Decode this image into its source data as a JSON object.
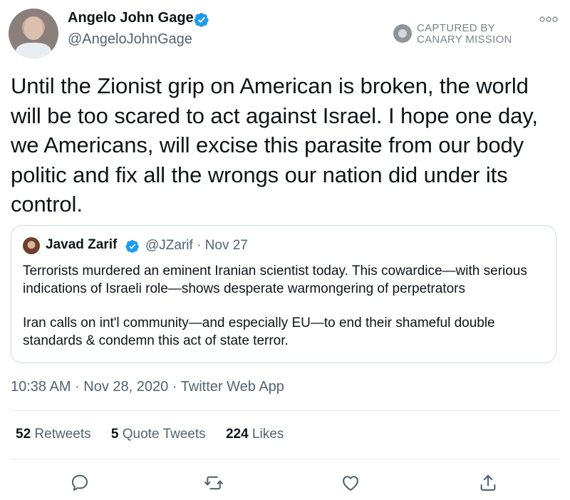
{
  "author": {
    "display_name": "Angelo John Gage",
    "handle": "@AngeloJohnGage",
    "verified": true
  },
  "watermark": {
    "line1": "CAPTURED BY",
    "line2": "CANARY MISSION"
  },
  "tweet": {
    "text": "Until the Zionist grip on American is broken, the world will be too scared to act against Israel. I hope one day, we Americans, will excise this parasite from our body politic and fix all the wrongs our nation did under its control.",
    "timestamp": "10:38 AM · Nov 28, 2020 · Twitter Web App"
  },
  "quoted_tweet": {
    "display_name": "Javad Zarif",
    "verified": true,
    "meta": "@JZarif · Nov 27",
    "paragraph1": "Terrorists murdered an eminent Iranian scientist today. This cowardice—with serious indications of Israeli role—shows desperate warmongering of perpetrators",
    "paragraph2": "Iran calls on int'l community—and especially EU—to end their shameful double standards & condemn this act of state terror."
  },
  "stats": [
    {
      "count": "52",
      "label": "Retweets"
    },
    {
      "count": "5",
      "label": "Quote Tweets"
    },
    {
      "count": "224",
      "label": "Likes"
    }
  ],
  "actions": [
    "reply-icon",
    "retweet-icon",
    "like-icon",
    "share-icon"
  ],
  "colors": {
    "verified": "#1d9bf0",
    "secondary_text": "#536471",
    "primary_text": "#0f1419",
    "border": "#cfd9de"
  }
}
